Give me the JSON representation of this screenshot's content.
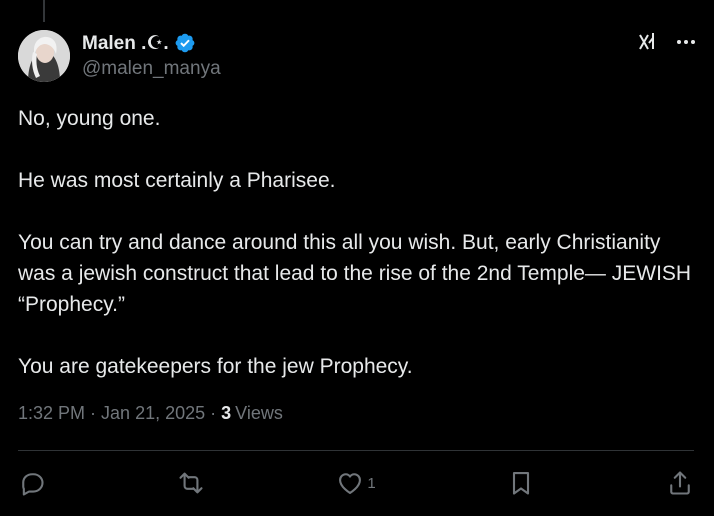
{
  "author": {
    "display_name": "Malen .☪.",
    "handle": "@malen_manya"
  },
  "tweet": {
    "paragraphs": [
      "No, young one.",
      "He was most certainly a Pharisee.",
      "You can try and dance around this all you wish. But, early Christianity was a jewish construct that lead to the rise of the 2nd Temple— JEWISH “Prophecy.”",
      "You are gatekeepers for the jew Prophecy."
    ]
  },
  "meta": {
    "time": "1:32 PM",
    "separator": "·",
    "date": "Jan 21, 2025",
    "views_count": "3",
    "views_label": "Views"
  },
  "actions": {
    "reply_icon": "reply-icon",
    "retweet_icon": "retweet-icon",
    "like_icon": "heart-icon",
    "like_count": "1",
    "bookmark_icon": "bookmark-icon",
    "share_icon": "share-icon"
  },
  "colors": {
    "background": "#000000",
    "text": "#e7e9ea",
    "muted": "#71767b",
    "verified": "#1d9bf0",
    "divider": "#2f3336"
  }
}
